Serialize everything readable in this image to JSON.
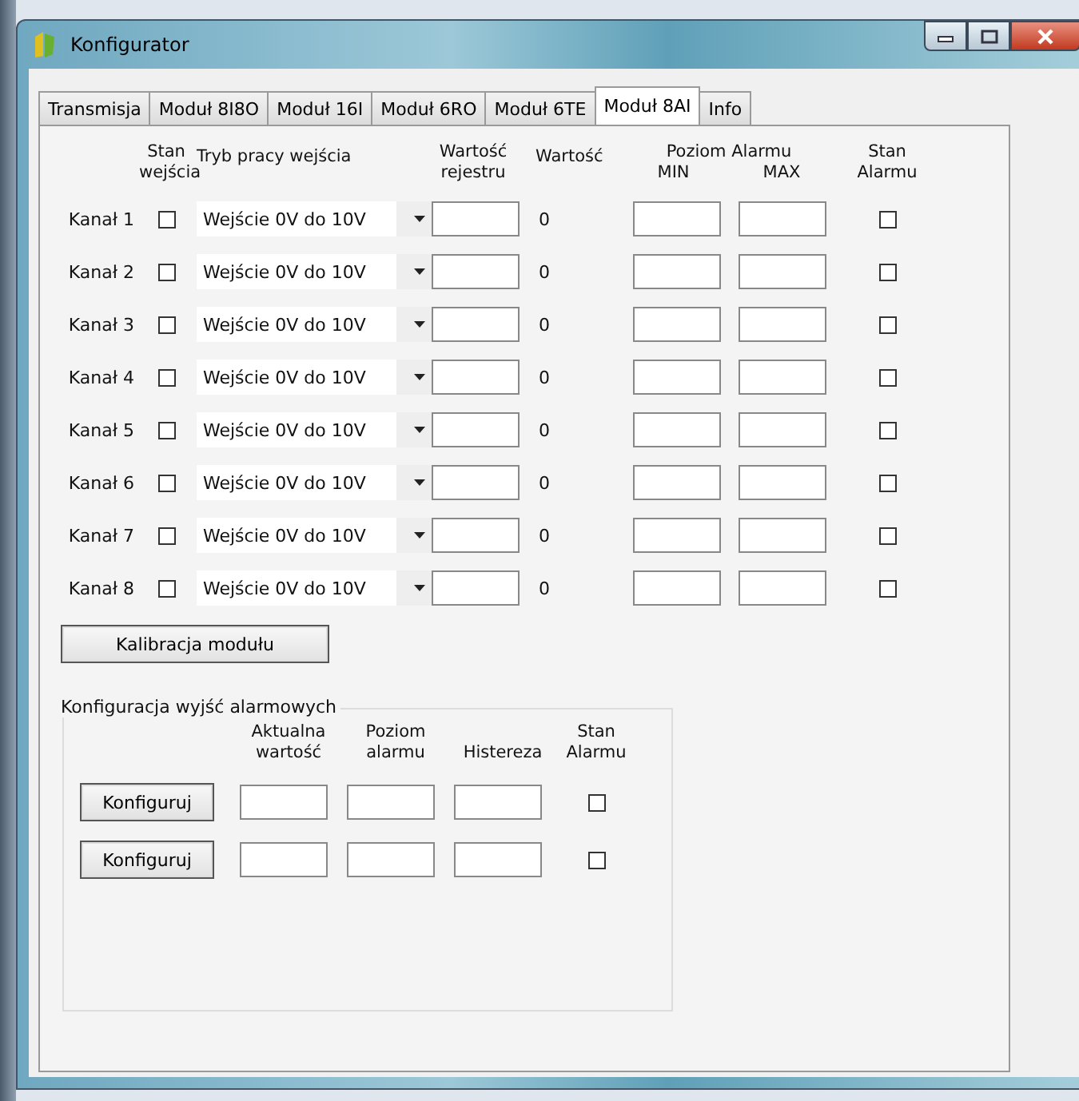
{
  "window": {
    "title": "Konfigurator"
  },
  "tabs": [
    {
      "label": "Transmisja",
      "selected": false
    },
    {
      "label": "Moduł 8I8O",
      "selected": false
    },
    {
      "label": "Moduł 16I",
      "selected": false
    },
    {
      "label": "Moduł 6RO",
      "selected": false
    },
    {
      "label": "Moduł 6TE",
      "selected": false
    },
    {
      "label": "Moduł 8AI",
      "selected": true
    },
    {
      "label": "Info",
      "selected": false
    }
  ],
  "channel_headers": {
    "input_state": "Stan\nwejścia",
    "mode": "Tryb pracy wejścia",
    "register": "Wartość\nrejestru",
    "value": "Wartość",
    "alarm_level": "Poziom Alarmu",
    "min": "MIN",
    "max": "MAX",
    "alarm_state": "Stan\nAlarmu"
  },
  "channels": [
    {
      "label": "Kanał 1",
      "input_state": false,
      "mode": "Wejście 0V do 10V",
      "value": "0",
      "alarm_state": false
    },
    {
      "label": "Kanał 2",
      "input_state": false,
      "mode": "Wejście 0V do 10V",
      "value": "0",
      "alarm_state": false
    },
    {
      "label": "Kanał 3",
      "input_state": false,
      "mode": "Wejście 0V do 10V",
      "value": "0",
      "alarm_state": false
    },
    {
      "label": "Kanał 4",
      "input_state": false,
      "mode": "Wejście 0V do 10V",
      "value": "0",
      "alarm_state": false
    },
    {
      "label": "Kanał 5",
      "input_state": false,
      "mode": "Wejście 0V do 10V",
      "value": "0",
      "alarm_state": false
    },
    {
      "label": "Kanał 6",
      "input_state": false,
      "mode": "Wejście 0V do 10V",
      "value": "0",
      "alarm_state": false
    },
    {
      "label": "Kanał 7",
      "input_state": false,
      "mode": "Wejście 0V do 10V",
      "value": "0",
      "alarm_state": false
    },
    {
      "label": "Kanał 8",
      "input_state": false,
      "mode": "Wejście 0V do 10V",
      "value": "0",
      "alarm_state": false
    }
  ],
  "calibrate_button": "Kalibracja modułu",
  "alarm_outputs": {
    "title": "Konfiguracja wyjść alarmowych",
    "headers": {
      "current": "Aktualna\nwartość",
      "level": "Poziom\nalarmu",
      "hysteresis": "Histereza",
      "state": "Stan\nAlarmu"
    },
    "rows": [
      {
        "button": "Konfiguruj",
        "alarm_state": false
      },
      {
        "button": "Konfiguruj",
        "alarm_state": false
      }
    ]
  }
}
